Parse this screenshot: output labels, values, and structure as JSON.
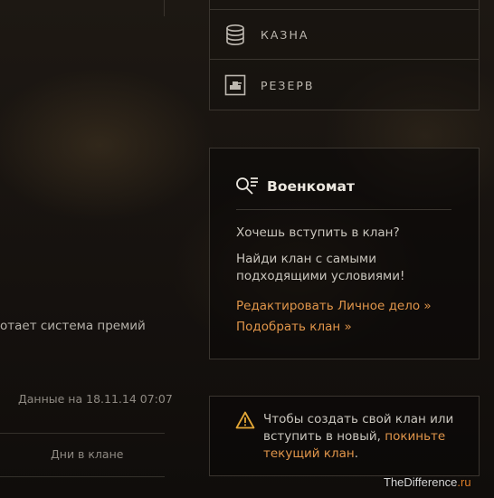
{
  "nav": {
    "items": [
      {
        "label": "КАЗНА",
        "icon": "coins-icon"
      },
      {
        "label": "РЕЗЕРВ",
        "icon": "reserve-icon"
      }
    ]
  },
  "left": {
    "premium_text": "отает система премий",
    "data_date": "Данные на 18.11.14 07:07",
    "days_in_clan": "Дни в клане"
  },
  "recruit": {
    "title": "Военкомат",
    "question": "Хочешь вступить в клан?",
    "find": "Найди клан с самыми подходящими условиями!",
    "edit_link": "Редактировать Личное дело »",
    "find_link": "Подобрать клан »"
  },
  "warning": {
    "text_before": "Чтобы создать свой клан или вступить в новый, ",
    "link": "покиньте текущий клан",
    "text_after": "."
  },
  "watermark": {
    "main": "TheDifference",
    "suffix": ".ru"
  },
  "colors": {
    "link": "#e0954a",
    "warning_icon": "#e3a736",
    "text": "#c9c5bd"
  }
}
